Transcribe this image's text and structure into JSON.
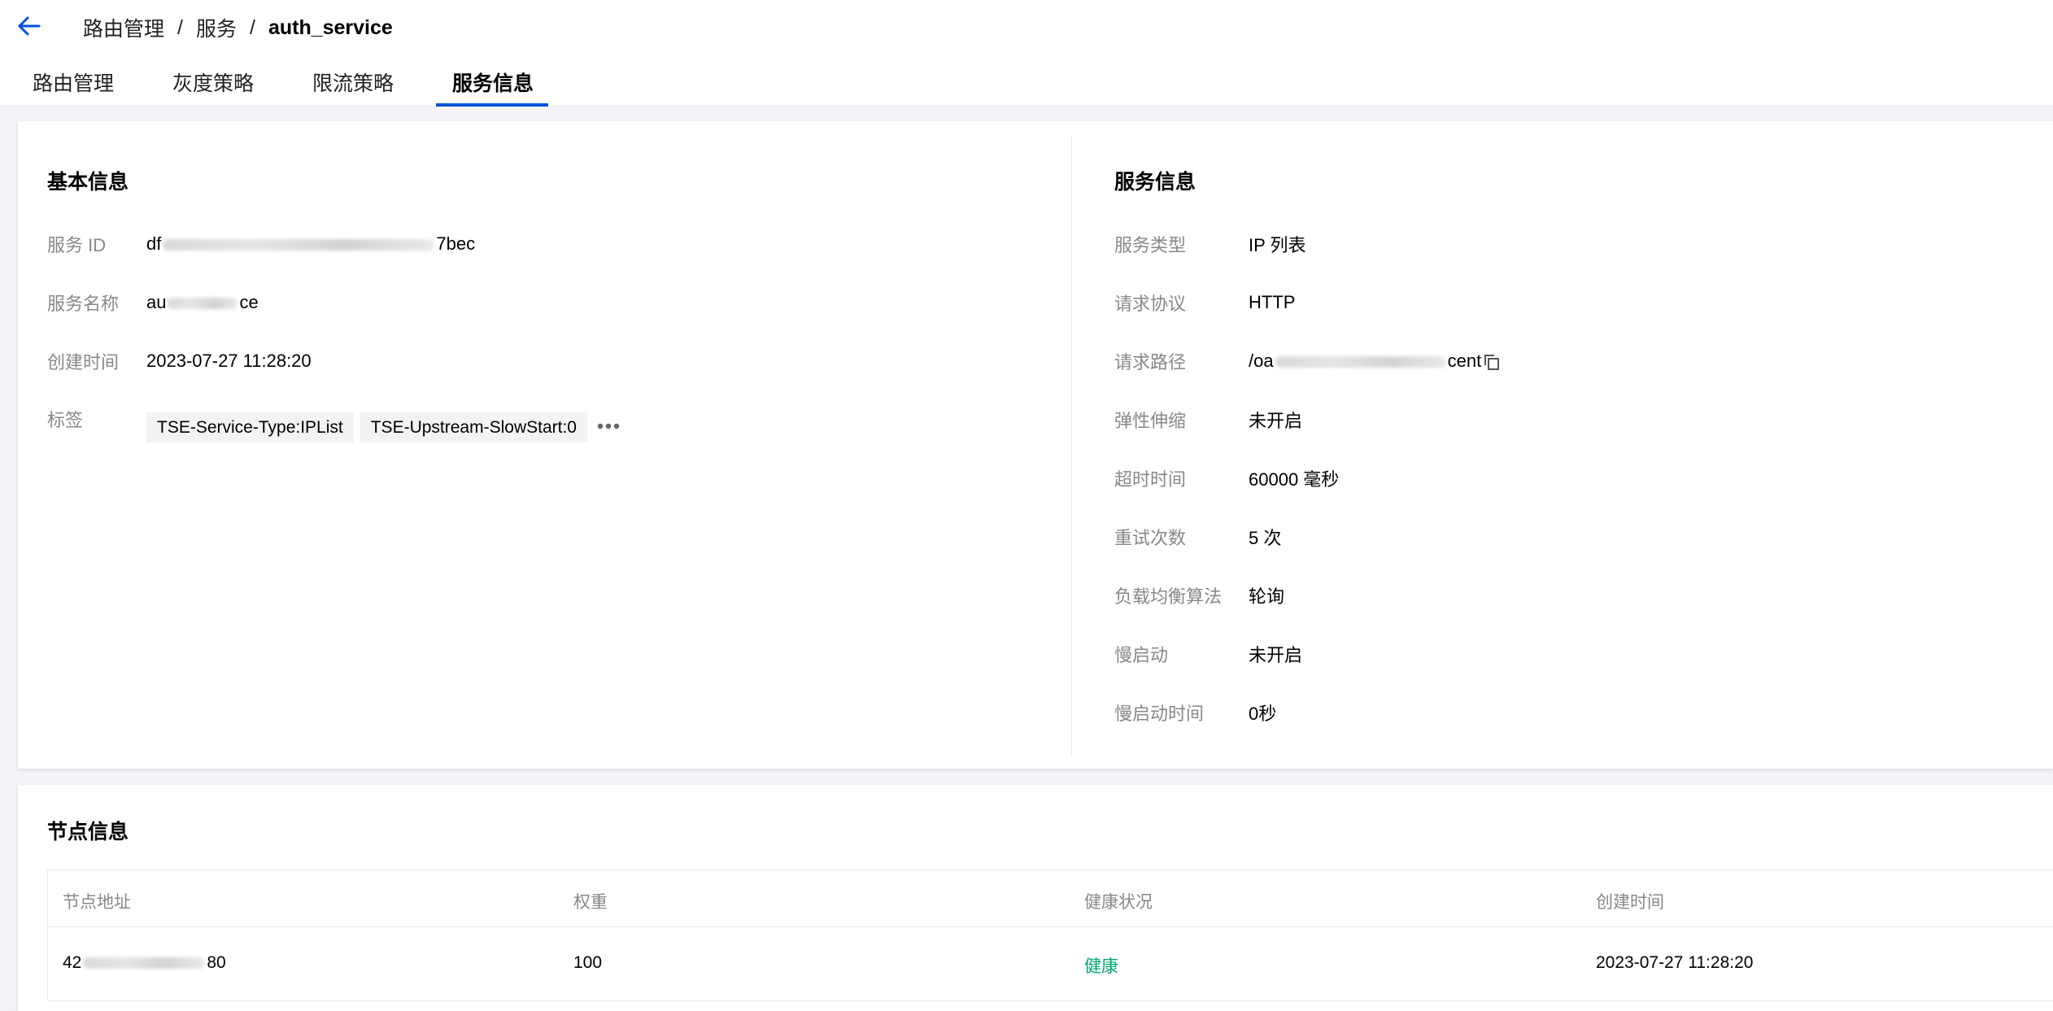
{
  "header": {
    "breadcrumb": [
      "路由管理",
      "服务",
      "auth_service"
    ],
    "separator": "/"
  },
  "tabs": [
    {
      "label": "路由管理",
      "active": false
    },
    {
      "label": "灰度策略",
      "active": false
    },
    {
      "label": "限流策略",
      "active": false
    },
    {
      "label": "服务信息",
      "active": true
    }
  ],
  "basic": {
    "title": "基本信息",
    "service_id": {
      "label": "服务 ID",
      "prefix": "df",
      "suffix": "7bec"
    },
    "service_name": {
      "label": "服务名称",
      "prefix": "au",
      "suffix": "ce"
    },
    "created": {
      "label": "创建时间",
      "value": "2023-07-27 11:28:20"
    },
    "tags": {
      "label": "标签",
      "items": [
        "TSE-Service-Type:IPList",
        "TSE-Upstream-SlowStart:0"
      ]
    }
  },
  "service": {
    "title": "服务信息",
    "type": {
      "label": "服务类型",
      "value": "IP 列表"
    },
    "protocol": {
      "label": "请求协议",
      "value": "HTTP"
    },
    "path": {
      "label": "请求路径",
      "prefix": "/oa",
      "suffix": "cent"
    },
    "autoscale": {
      "label": "弹性伸缩",
      "value": "未开启"
    },
    "timeout": {
      "label": "超时时间",
      "value": "60000 毫秒"
    },
    "retries": {
      "label": "重试次数",
      "value": "5 次"
    },
    "lb": {
      "label": "负载均衡算法",
      "value": "轮询"
    },
    "slow_start": {
      "label": "慢启动",
      "value": "未开启"
    },
    "slow_start_time": {
      "label": "慢启动时间",
      "value": "0秒"
    }
  },
  "nodes": {
    "title": "节点信息",
    "columns": [
      "节点地址",
      "权重",
      "健康状况",
      "创建时间"
    ],
    "rows": [
      {
        "address_prefix": "42",
        "address_suffix": "80",
        "weight": "100",
        "health": "健康",
        "created": "2023-07-27 11:28:20"
      }
    ]
  },
  "colors": {
    "accent": "#0052d9",
    "healthy": "#00a870",
    "label": "#888888"
  }
}
